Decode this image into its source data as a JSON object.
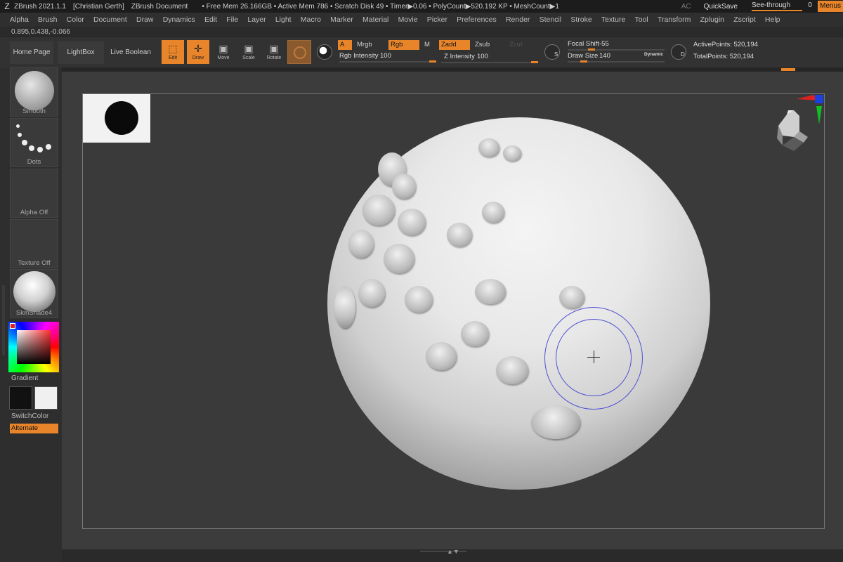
{
  "titlebar": {
    "app": "ZBrush 2021.1.1",
    "user": "[Christian Gerth]",
    "doc": "ZBrush Document",
    "stats": "• Free Mem 26.166GB • Active Mem 786 • Scratch Disk 49 • Timer▶0.06 • PolyCount▶520.192 KP • MeshCount▶1",
    "ac": "AC",
    "quicksave": "QuickSave",
    "seethrough_label": "See-through",
    "seethrough_value": "0",
    "menus": "Menus"
  },
  "menubar": {
    "items": [
      "Alpha",
      "Brush",
      "Color",
      "Document",
      "Draw",
      "Dynamics",
      "Edit",
      "File",
      "Layer",
      "Light",
      "Macro",
      "Marker",
      "Material",
      "Movie",
      "Picker",
      "Preferences",
      "Render",
      "Stencil",
      "Stroke",
      "Texture",
      "Tool",
      "Transform",
      "Zplugin",
      "Zscript",
      "Help"
    ]
  },
  "coords": "0.895,0.438,-0.066",
  "shelf": {
    "home_page": "Home Page",
    "lightbox": "LightBox",
    "live_boolean": "Live Boolean",
    "edit": "Edit",
    "draw": "Draw",
    "move": "Move",
    "scale": "Scale",
    "rotate": "Rotate",
    "a": "A",
    "mrgb": "Mrgb",
    "rgb": "Rgb",
    "m": "M",
    "zadd": "Zadd",
    "zsub": "Zsub",
    "zcut": "Zcut",
    "rgb_intensity_label": "Rgb Intensity",
    "rgb_intensity_value": "100",
    "rgb_intensity_level": 1.0,
    "z_intensity_label": "Z Intensity",
    "z_intensity_value": "100",
    "z_intensity_level": 1.0,
    "focal_shift_label": "Focal Shift",
    "focal_shift_value": "-55",
    "focal_shift_level": 0.225,
    "draw_size_label": "Draw Size",
    "draw_size_value": "140",
    "draw_size_level": 0.14,
    "dynamic": "Dynamic",
    "s_label": "S",
    "d_label": "D",
    "active_points": "ActivePoints: 520,194",
    "total_points": "TotalPoints: 520,194"
  },
  "left": {
    "brush": "Smooth",
    "stroke": "Dots",
    "alpha": "Alpha Off",
    "texture": "Texture Off",
    "material": "SkinShade4",
    "gradient": "Gradient",
    "switch_color": "SwitchColor",
    "alternate": "Alternate"
  },
  "colors": {
    "accent": "#e8852a",
    "primary_color": "#111111",
    "secondary_color": "#f0f0f0",
    "brush_cursor": "#4f4fd6"
  }
}
